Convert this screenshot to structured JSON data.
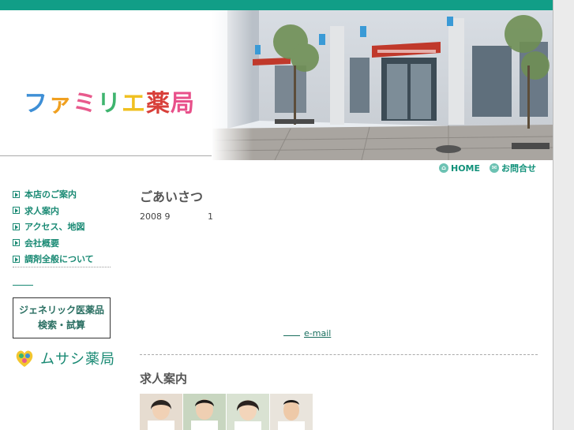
{
  "brand": {
    "logo_chars": [
      {
        "ch": "フ",
        "color": "#3e8fd6"
      },
      {
        "ch": "ァ",
        "color": "#f0a020"
      },
      {
        "ch": "ミ",
        "color": "#e85a8c"
      },
      {
        "ch": "リ",
        "color": "#3eb46e"
      },
      {
        "ch": "エ",
        "color": "#f0c020"
      },
      {
        "ch": "薬",
        "color": "#d8403a"
      },
      {
        "ch": "局",
        "color": "#e8508a"
      }
    ]
  },
  "topnav": {
    "home": "HOME",
    "contact": "お問合せ"
  },
  "sidebar": {
    "items": [
      {
        "label": "本店のご案内"
      },
      {
        "label": "求人案内"
      },
      {
        "label": "アクセス、地図"
      },
      {
        "label": "会社概要"
      },
      {
        "label": "調剤全般について"
      }
    ],
    "generic_box": {
      "line1": "ジェネリック医薬品",
      "line2": "検索・試算"
    },
    "partner": {
      "name": "ムサシ薬局"
    }
  },
  "main": {
    "greeting_title": "ごあいさつ",
    "date_year_month": "2008 9",
    "date_day": "1",
    "email_label": "e-mail",
    "recruit_title": "求人案内"
  },
  "colors": {
    "accent": "#119e87",
    "link": "#1a8a74"
  }
}
